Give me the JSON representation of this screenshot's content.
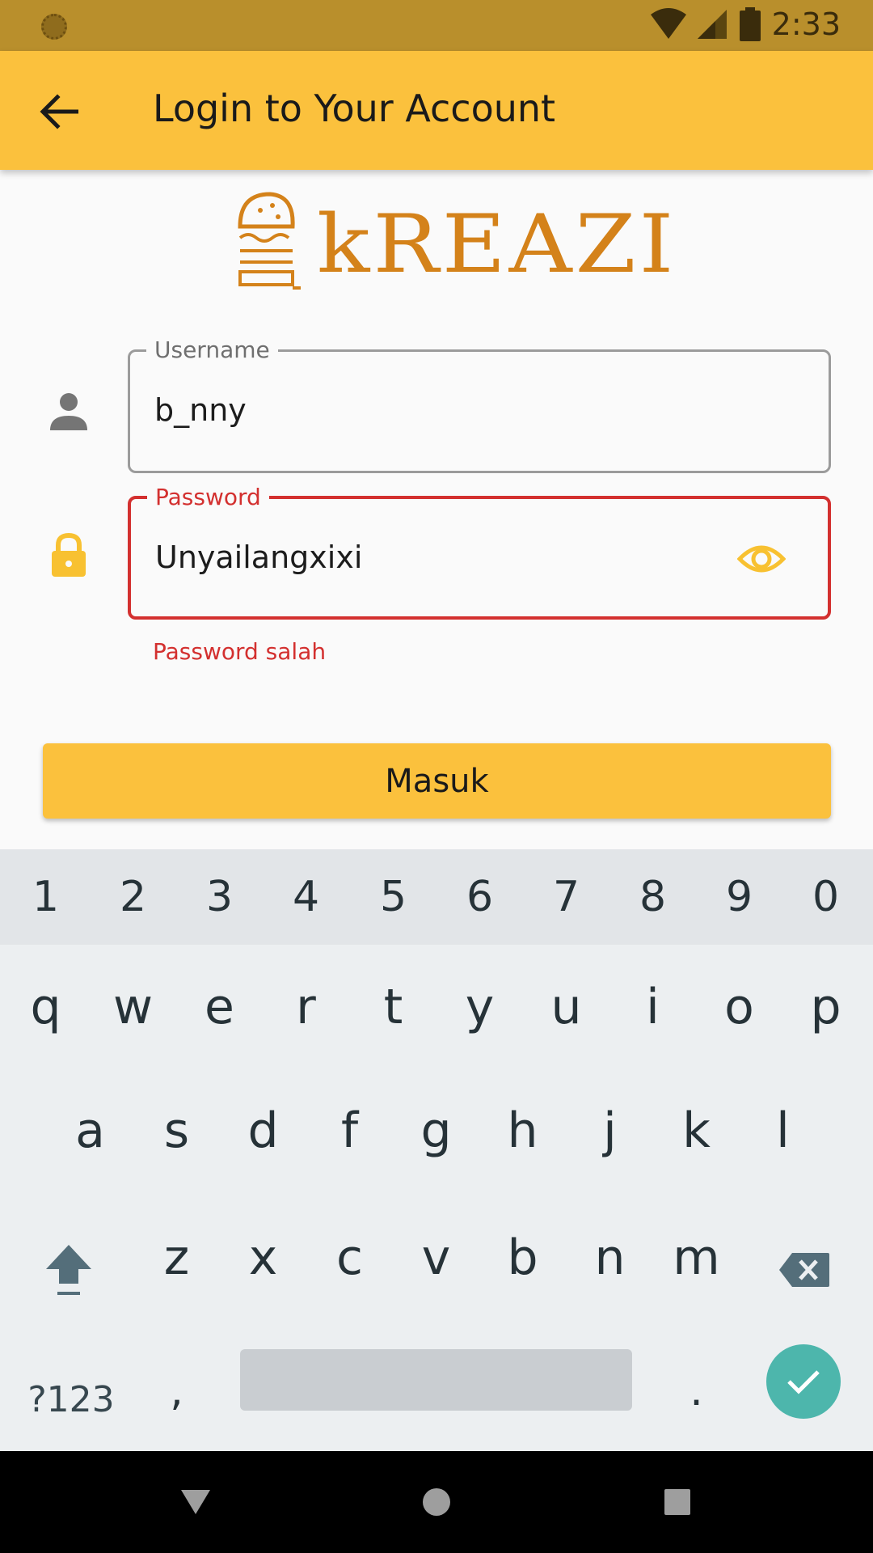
{
  "status_bar": {
    "time": "2:33",
    "icons": [
      "wifi-icon",
      "signal-icon",
      "battery-icon"
    ]
  },
  "app_bar": {
    "title": "Login to Your Account",
    "back_icon": "arrow-back-icon"
  },
  "logo": {
    "text": "kREAZI"
  },
  "username": {
    "label": "Username",
    "value": "b_nny",
    "icon": "person-icon"
  },
  "password": {
    "label": "Password",
    "value": "Unyailangxixi",
    "icon": "lock-icon",
    "toggle_icon": "eye-icon",
    "error": "Password salah"
  },
  "submit": {
    "label": "Masuk"
  },
  "keyboard": {
    "numbers": [
      "1",
      "2",
      "3",
      "4",
      "5",
      "6",
      "7",
      "8",
      "9",
      "0"
    ],
    "row1": [
      "q",
      "w",
      "e",
      "r",
      "t",
      "y",
      "u",
      "i",
      "o",
      "p"
    ],
    "row2": [
      "a",
      "s",
      "d",
      "f",
      "g",
      "h",
      "j",
      "k",
      "l"
    ],
    "row3": [
      "z",
      "x",
      "c",
      "v",
      "b",
      "n",
      "m"
    ],
    "symbols_label": "?123",
    "comma": ",",
    "period": "."
  },
  "colors": {
    "accent": "#fbc13d",
    "status_bar": "#b98f2c",
    "error": "#d3302f",
    "logo": "#d4821a",
    "enter": "#4db6ac"
  }
}
